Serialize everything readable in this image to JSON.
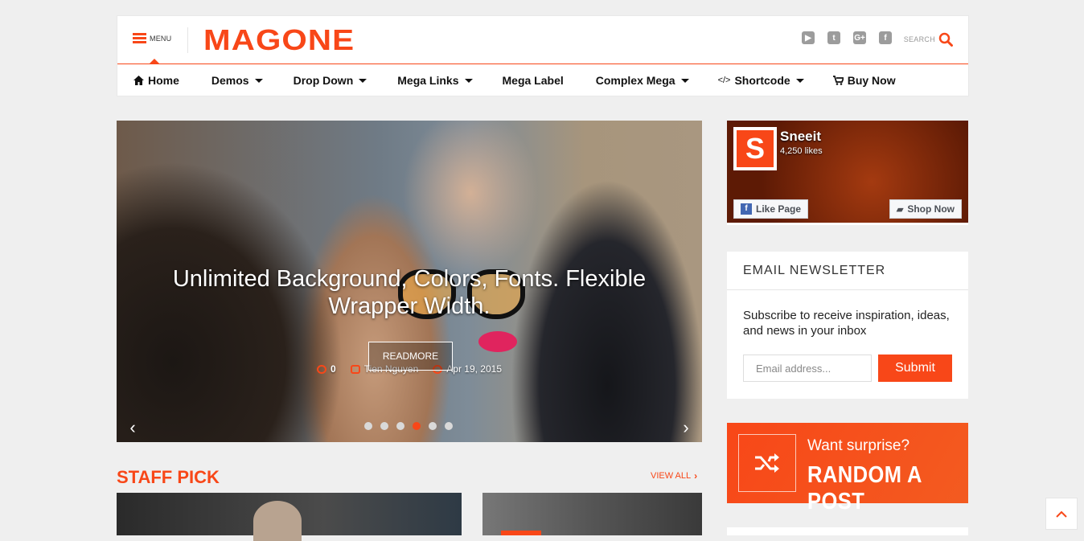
{
  "header": {
    "menu_label": "MENU",
    "logo": "MAGONE",
    "social": [
      {
        "icon": "youtube-icon",
        "glyph": "▶"
      },
      {
        "icon": "twitter-icon",
        "glyph": "t"
      },
      {
        "icon": "google-plus-icon",
        "glyph": "G+"
      },
      {
        "icon": "facebook-icon",
        "glyph": "f"
      }
    ],
    "search_label": "SEARCH"
  },
  "nav": [
    {
      "label": "Home",
      "icon": "home-icon"
    },
    {
      "label": "Demos",
      "dropdown": true
    },
    {
      "label": "Drop Down",
      "dropdown": true
    },
    {
      "label": "Mega Links",
      "dropdown": true
    },
    {
      "label": "Mega Label"
    },
    {
      "label": "Complex Mega",
      "dropdown": true
    },
    {
      "label": "Shortcode",
      "icon": "code-icon",
      "dropdown": true
    },
    {
      "label": "Buy Now",
      "icon": "cart-icon"
    }
  ],
  "slider": {
    "comments": "0",
    "author": "Tien Nguyen",
    "date": "Apr 19, 2015",
    "title": "Unlimited Background, Colors, Fonts. Flexible Wrapper Width.",
    "readmore": "READMORE",
    "dot_count": 6,
    "active_dot": 4
  },
  "staff_pick": {
    "title": "STAFF PICK",
    "view_all": "VIEW ALL"
  },
  "facebook": {
    "name": "Sneeit",
    "likes": "4,250 likes",
    "like_btn": "Like Page",
    "shop_btn": "Shop Now"
  },
  "newsletter": {
    "heading": "EMAIL NEWSLETTER",
    "text": "Subscribe to receive inspiration, ideas, and news in your inbox",
    "placeholder": "Email address...",
    "submit": "Submit"
  },
  "random": {
    "small": "Want surprise?",
    "big": "RANDOM A POST"
  },
  "colors": {
    "accent": "#f84718",
    "background": "#efefef"
  }
}
